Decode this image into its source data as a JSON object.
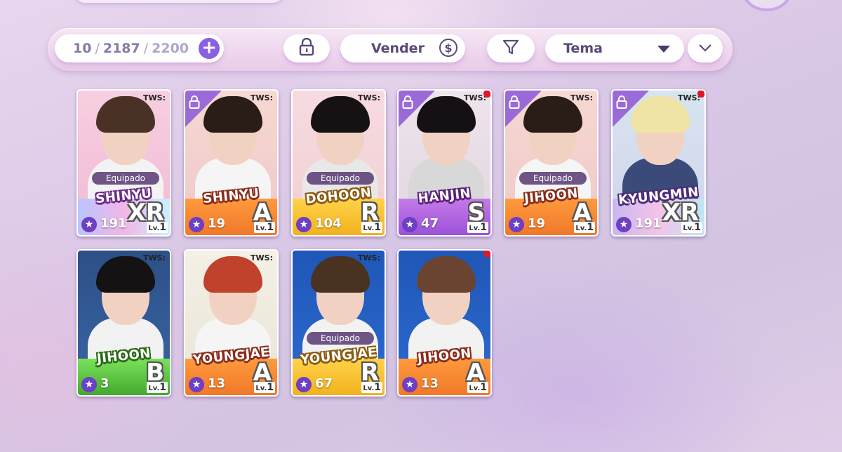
{
  "inventory": {
    "current": "10",
    "used": "2187",
    "max": "2200"
  },
  "toolbar": {
    "sell_label": "Vender",
    "coin_symbol": "$",
    "theme_label": "Tema"
  },
  "colors": {
    "accent": "#8b5ee6",
    "lock_corner": "#9a6ad8",
    "new_dot": "#e0162b",
    "grade_XR": "#c9b7ec",
    "grade_A": "#f0782a",
    "grade_R": "#f2b21e",
    "grade_S": "#b066e0",
    "grade_B": "#55c043"
  },
  "cards": [
    {
      "brand": "TWS:",
      "name": "SHINYU",
      "power": "191",
      "grade": "XR",
      "lv_prefix": "Lv.",
      "lv": "1",
      "equipped": true,
      "equip_label": "Equipado",
      "locked": false,
      "new": false,
      "theme": "pink"
    },
    {
      "brand": "TWS:",
      "name": "SHINYU",
      "power": "19",
      "grade": "A",
      "lv_prefix": "Lv.",
      "lv": "1",
      "equipped": false,
      "locked": true,
      "new": false,
      "theme": "orange"
    },
    {
      "brand": "TWS:",
      "name": "DOHOON",
      "power": "104",
      "grade": "R",
      "lv_prefix": "Lv.",
      "lv": "1",
      "equipped": true,
      "equip_label": "Equipado",
      "locked": false,
      "new": false,
      "theme": "yellow"
    },
    {
      "brand": "TWS:",
      "name": "HANJIN",
      "power": "47",
      "grade": "S",
      "lv_prefix": "Lv.",
      "lv": "1",
      "equipped": false,
      "locked": true,
      "new": true,
      "theme": "purple"
    },
    {
      "brand": "TWS:",
      "name": "JIHOON",
      "power": "19",
      "grade": "A",
      "lv_prefix": "Lv.",
      "lv": "1",
      "equipped": true,
      "equip_label": "Equipado",
      "locked": true,
      "new": false,
      "theme": "orange"
    },
    {
      "brand": "TWS:",
      "name": "KYUNGMIN",
      "power": "191",
      "grade": "XR",
      "lv_prefix": "Lv.",
      "lv": "1",
      "equipped": false,
      "locked": true,
      "new": true,
      "theme": "holo"
    },
    {
      "brand": "TWS:",
      "name": "JIHOON",
      "power": "3",
      "grade": "B",
      "lv_prefix": "Lv.",
      "lv": "1",
      "equipped": false,
      "locked": false,
      "new": false,
      "theme": "green"
    },
    {
      "brand": "TWS:",
      "name": "YOUNGJAE",
      "power": "13",
      "grade": "A",
      "lv_prefix": "Lv.",
      "lv": "1",
      "equipped": false,
      "locked": false,
      "new": false,
      "theme": "orange-star"
    },
    {
      "brand": "TWS:",
      "name": "YOUNGJAE",
      "power": "67",
      "grade": "R",
      "lv_prefix": "Lv.",
      "lv": "1",
      "equipped": true,
      "equip_label": "Equipado",
      "locked": false,
      "new": false,
      "theme": "yellow-blue"
    },
    {
      "brand": "",
      "name": "JIHOON",
      "power": "13",
      "grade": "A",
      "lv_prefix": "Lv.",
      "lv": "1",
      "equipped": false,
      "locked": false,
      "new": true,
      "theme": "orange-blue"
    }
  ]
}
